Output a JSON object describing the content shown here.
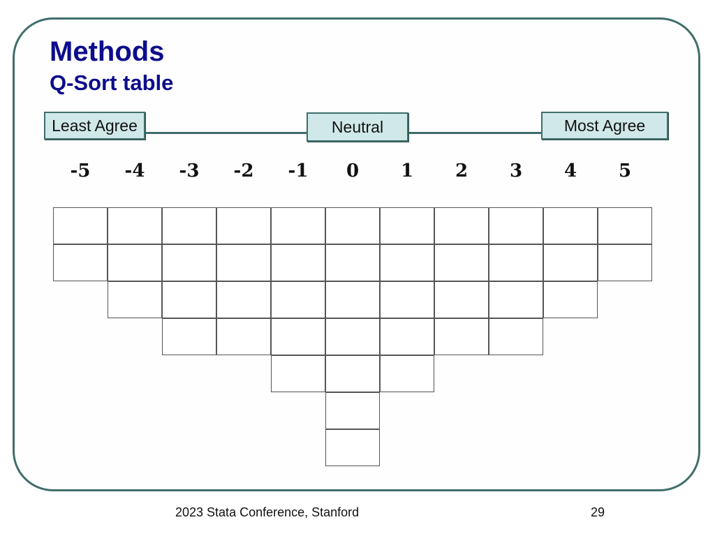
{
  "slide": {
    "title": "Methods",
    "subtitle": "Q-Sort table",
    "page_number": "29",
    "footer_text": "2023 Stata Conference, Stanford"
  },
  "scale": {
    "least_label": "Least Agree",
    "neutral_label": "Neutral",
    "most_label": "Most Agree"
  },
  "qsort": {
    "columns": [
      {
        "label": "-5",
        "slots": 2
      },
      {
        "label": "-4",
        "slots": 3
      },
      {
        "label": "-3",
        "slots": 4
      },
      {
        "label": "-2",
        "slots": 4
      },
      {
        "label": "-1",
        "slots": 5
      },
      {
        "label": "0",
        "slots": 7
      },
      {
        "label": "1",
        "slots": 5
      },
      {
        "label": "2",
        "slots": 4
      },
      {
        "label": "3",
        "slots": 4
      },
      {
        "label": "4",
        "slots": 3
      },
      {
        "label": "5",
        "slots": 2
      }
    ]
  },
  "colors": {
    "title": "#0d0d8c",
    "frame": "#3f6e6a",
    "scale_box_fill": "#d0e8e8"
  }
}
